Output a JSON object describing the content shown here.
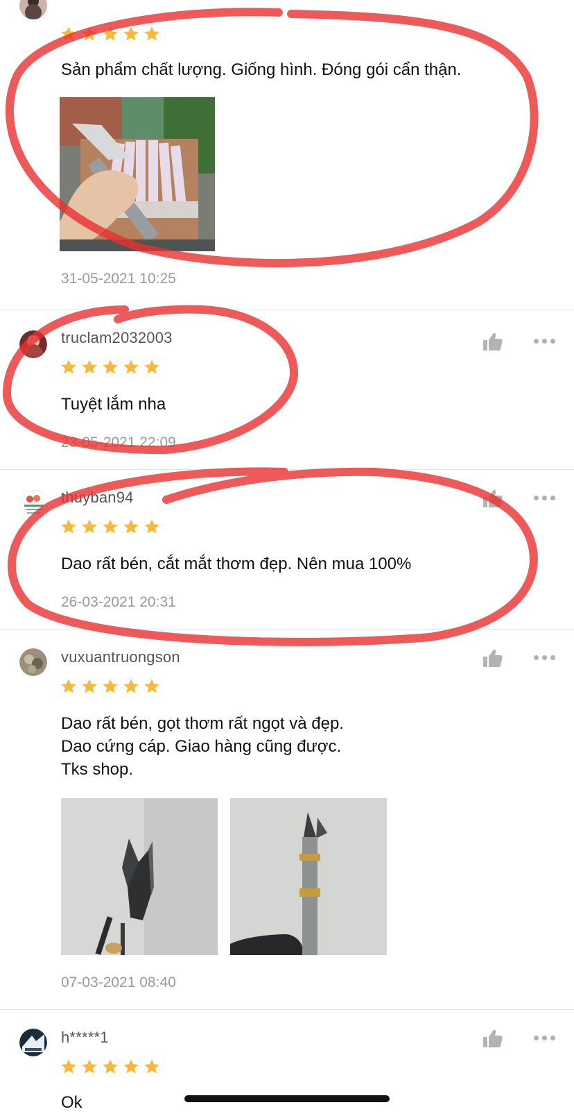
{
  "reviews": [
    {
      "username": "",
      "rating": 5,
      "comment": "Sản phẩm chất lượng. Giống hình. Đóng gói cẩn thận.",
      "date": "31-05-2021 10:25",
      "photos": [
        "knife-with-notes-photo"
      ]
    },
    {
      "username": "truclam2032003",
      "rating": 5,
      "comment": "Tuyệt lắm nha",
      "date": "23-05-2021 22:09",
      "photos": []
    },
    {
      "username": "thuyban94",
      "rating": 5,
      "comment": "Dao rất bén, cắt mắt thơm đẹp. Nên mua 100%",
      "date": "26-03-2021 20:31",
      "photos": []
    },
    {
      "username": "vuxuantruongson",
      "rating": 5,
      "comment": "Dao rất bén, gọt thơm rất ngọt và đẹp.\nDao cứng cáp. Giao hàng cũng được.\nTks shop.",
      "date": "07-03-2021 08:40",
      "photos": [
        "knife-blade-closeup-photo",
        "knife-held-photo"
      ]
    },
    {
      "username": "h*****1",
      "rating": 5,
      "comment": "Ok",
      "date": "",
      "photos": []
    }
  ],
  "colors": {
    "star": "#f6b93b",
    "annotation": "#e8312f",
    "divider": "#e5e5e5",
    "meta_text": "#999999"
  },
  "icons": [
    "thumbs-up-icon",
    "more-dots-icon",
    "star-icon"
  ]
}
